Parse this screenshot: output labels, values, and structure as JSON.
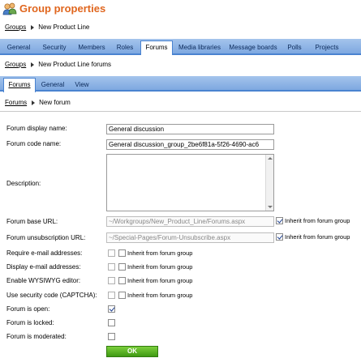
{
  "header": {
    "title": "Group properties",
    "icon": "group-users-icon"
  },
  "breadcrumb1": {
    "link": "Groups",
    "current": "New Product Line"
  },
  "main_tabs": [
    "General",
    "Security",
    "Members",
    "Roles",
    "Forums",
    "Media libraries",
    "Message boards",
    "Polls",
    "Projects"
  ],
  "main_tab_active": "Forums",
  "breadcrumb2": {
    "link": "Groups",
    "current": "New Product Line forums"
  },
  "sub_tabs": [
    "Forums",
    "General",
    "View"
  ],
  "sub_tab_active": "Forums",
  "breadcrumb3": {
    "link": "Forums",
    "current": "New forum"
  },
  "form": {
    "display_name": {
      "label": "Forum display name:",
      "value": "General discussion"
    },
    "code_name": {
      "label": "Forum code name:",
      "value": "General discussion_group_2be6f81a-5f26-4690-ac6"
    },
    "description": {
      "label": "Description:",
      "value": ""
    },
    "base_url": {
      "label": "Forum base URL:",
      "value": "~/Workgroups/New_Product_Line/Forums.aspx",
      "inherit_label": "Inherit from forum group",
      "inherit_checked": true
    },
    "unsub_url": {
      "label": "Forum unsubscription URL:",
      "value": "~/Special-Pages/Forum-Unsubscribe.aspx",
      "inherit_label": "Inherit from forum group",
      "inherit_checked": true
    },
    "require_email": {
      "label": "Require e-mail addresses:",
      "inherit_label": "Inherit from forum group"
    },
    "display_email": {
      "label": "Display e-mail addresses:",
      "inherit_label": "Inherit from forum group"
    },
    "wysiwyg": {
      "label": "Enable WYSIWYG editor:",
      "inherit_label": "Inherit from forum group"
    },
    "captcha": {
      "label": "Use security code (CAPTCHA):",
      "inherit_label": "Inherit from forum group"
    },
    "is_open": {
      "label": "Forum is open:",
      "checked": true
    },
    "is_locked": {
      "label": "Forum is locked:",
      "checked": false
    },
    "is_moderated": {
      "label": "Forum is moderated:",
      "checked": false
    },
    "ok_label": "OK"
  },
  "colors": {
    "title": "#e0661e",
    "tabbar": "#7ea8e0",
    "ok_button": "#4fa51c"
  }
}
